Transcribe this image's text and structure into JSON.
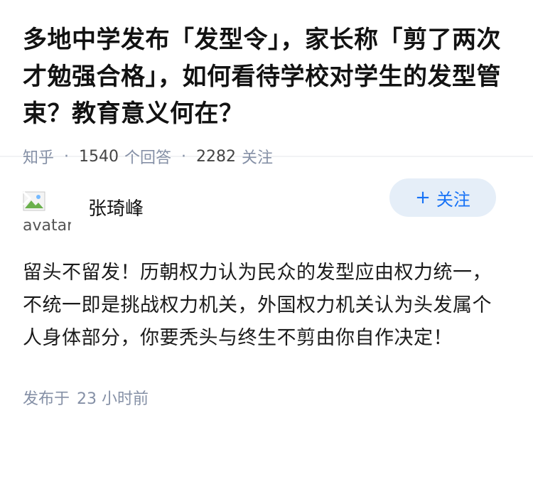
{
  "question": {
    "title": "多地中学发布「发型令」，家长称「剪了两次才勉强合格」，如何看待学校对学生的发型管束？教育意义何在？",
    "source": "知乎",
    "answers_count": "1540",
    "answers_label": "个回答",
    "followers_count": "2282",
    "followers_label": "关注"
  },
  "answer": {
    "author": {
      "name": "张琦峰",
      "avatar_alt": "avatar",
      "follow_label": "关注"
    },
    "content": "留头不留发！历朝权力认为民众的发型应由权力统一，不统一即是挑战权力机关，外国权力机关认为头发属个人身体部分，你要秃头与终生不剪由你自作决定！",
    "published_label": "发布于",
    "published_time": "23 小时前"
  },
  "colors": {
    "accent": "#1772f6",
    "follow_bg": "#e5eef8",
    "meta_text": "#8590a6"
  }
}
